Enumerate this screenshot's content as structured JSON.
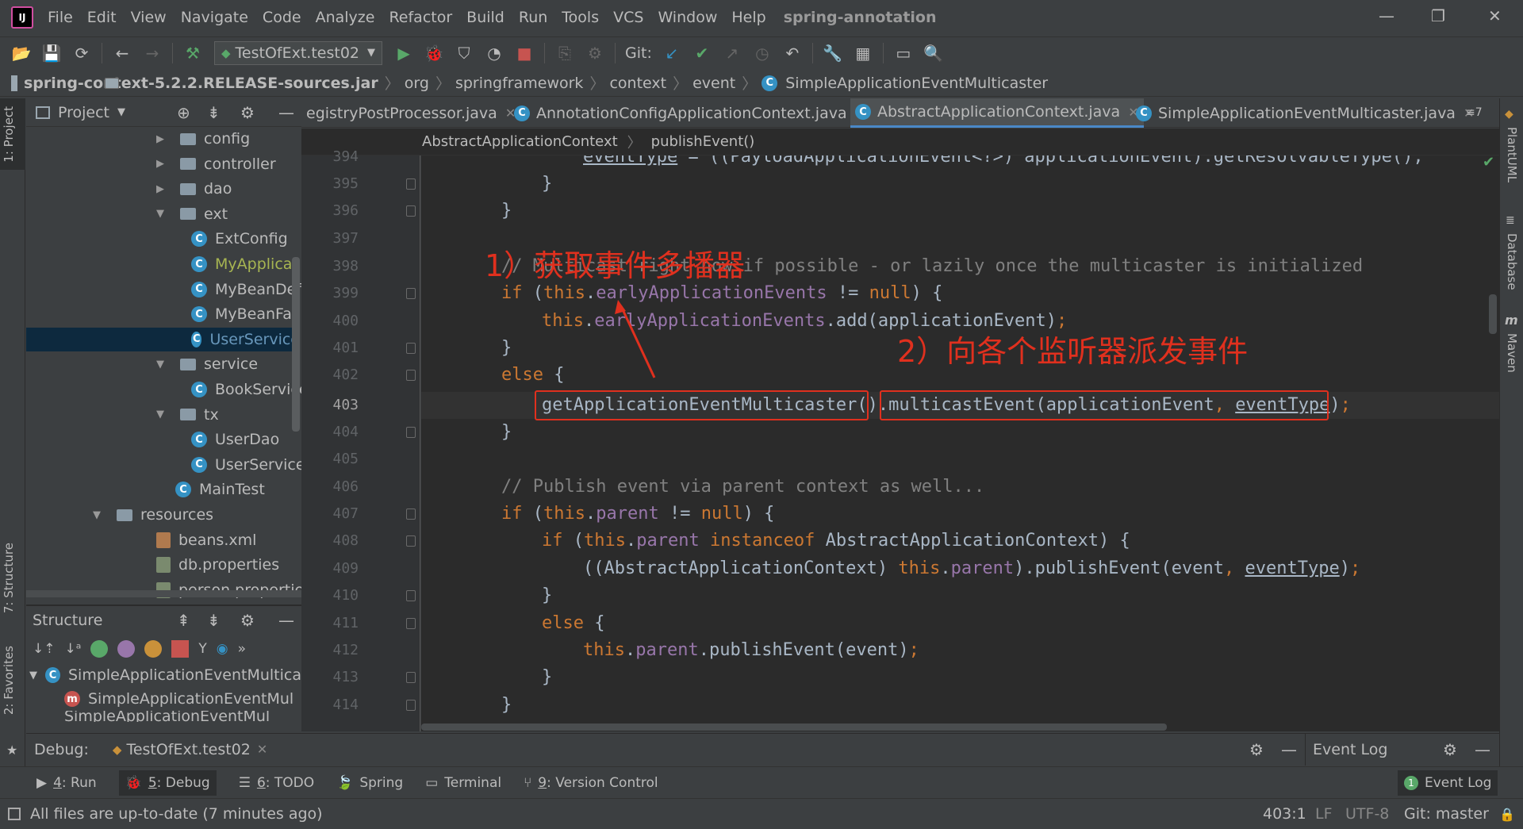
{
  "window": {
    "project_name": "spring-annotation",
    "menu": [
      "File",
      "Edit",
      "View",
      "Navigate",
      "Code",
      "Analyze",
      "Refactor",
      "Build",
      "Run",
      "Tools",
      "VCS",
      "Window",
      "Help"
    ]
  },
  "toolbar": {
    "run_config": "TestOfExt.test02",
    "git_label": "Git:"
  },
  "navbar": {
    "crumbs": [
      "spring-context-5.2.2.RELEASE-sources.jar",
      "org",
      "springframework",
      "context",
      "event",
      "SimpleApplicationEventMulticaster"
    ]
  },
  "left_strip": {
    "project": "1: Project",
    "structure": "7: Structure",
    "favorites": "2: Favorites"
  },
  "right_strip": {
    "plantuml": "PlantUML",
    "database": "Database",
    "maven": "Maven"
  },
  "project_panel": {
    "title": "Project",
    "tree": [
      {
        "label": "config",
        "type": "folder",
        "level": 1,
        "expanded": false
      },
      {
        "label": "controller",
        "type": "folder",
        "level": 1,
        "expanded": false
      },
      {
        "label": "dao",
        "type": "folder",
        "level": 1,
        "expanded": false
      },
      {
        "label": "ext",
        "type": "folder",
        "level": 1,
        "expanded": true
      },
      {
        "label": "ExtConfig",
        "type": "class",
        "level": 2
      },
      {
        "label": "MyApplicat",
        "type": "class",
        "level": 2,
        "modified": true
      },
      {
        "label": "MyBeanDef",
        "type": "class",
        "level": 2
      },
      {
        "label": "MyBeanFac",
        "type": "class",
        "level": 2
      },
      {
        "label": "UserService",
        "type": "class",
        "level": 2,
        "selected": true
      },
      {
        "label": "service",
        "type": "folder",
        "level": 1,
        "expanded": true
      },
      {
        "label": "BookService",
        "type": "class",
        "level": 2
      },
      {
        "label": "tx",
        "type": "folder",
        "level": 1,
        "expanded": true
      },
      {
        "label": "UserDao",
        "type": "class",
        "level": 2
      },
      {
        "label": "UserService",
        "type": "class",
        "level": 2
      },
      {
        "label": "MainTest",
        "type": "class",
        "level": 1.5
      },
      {
        "label": "resources",
        "type": "folder",
        "level": 0,
        "expanded": true
      },
      {
        "label": "beans.xml",
        "type": "xml",
        "level": 1
      },
      {
        "label": "db.properties",
        "type": "props",
        "level": 1
      },
      {
        "label": "person.properties",
        "type": "props",
        "level": 1
      }
    ]
  },
  "structure_panel": {
    "title": "Structure",
    "items": [
      "SimpleApplicationEventMultica",
      "SimpleApplicationEventMul",
      "SimpleApplicationEventMul"
    ]
  },
  "editor": {
    "tabs": [
      {
        "label": "egistryPostProcessor.java"
      },
      {
        "label": "AnnotationConfigApplicationContext.java"
      },
      {
        "label": "AbstractApplicationContext.java",
        "active": true
      },
      {
        "label": "SimpleApplicationEventMulticaster.java"
      }
    ],
    "tab_overflow": "≡7",
    "breadcrumb": [
      "AbstractApplicationContext",
      "publishEvent()"
    ],
    "line_numbers": [
      "394",
      "395",
      "396",
      "397",
      "398",
      "399",
      "400",
      "401",
      "402",
      "403",
      "404",
      "405",
      "406",
      "407",
      "408",
      "409",
      "410",
      "411",
      "412",
      "413",
      "414"
    ],
    "current_line": "403",
    "annotation_1": "1）获取事件多播器",
    "annotation_2": "2）向各个监听器派发事件"
  },
  "debug_bar": {
    "label": "Debug:",
    "session": "TestOfExt.test02",
    "event_log": "Event Log"
  },
  "tool_windows": [
    {
      "num": "4",
      "label": ": Run"
    },
    {
      "num": "5",
      "label": ": Debug",
      "active": true
    },
    {
      "num": "6",
      "label": ": TODO"
    },
    {
      "num": "",
      "label": "Spring"
    },
    {
      "num": "",
      "label": "Terminal"
    },
    {
      "num": "9",
      "label": ": Version Control"
    }
  ],
  "event_log_button": {
    "badge": "1",
    "label": "Event Log"
  },
  "status": {
    "message": "All files are up-to-date (7 minutes ago)",
    "position": "403:1",
    "line_sep": "LF",
    "encoding": "UTF-8",
    "branch": "Git: master"
  },
  "colors": {
    "keyword": "#cc7832",
    "field": "#9876aa",
    "comment": "#808080",
    "annotation": "#e0301e",
    "accent": "#4a88c7"
  }
}
